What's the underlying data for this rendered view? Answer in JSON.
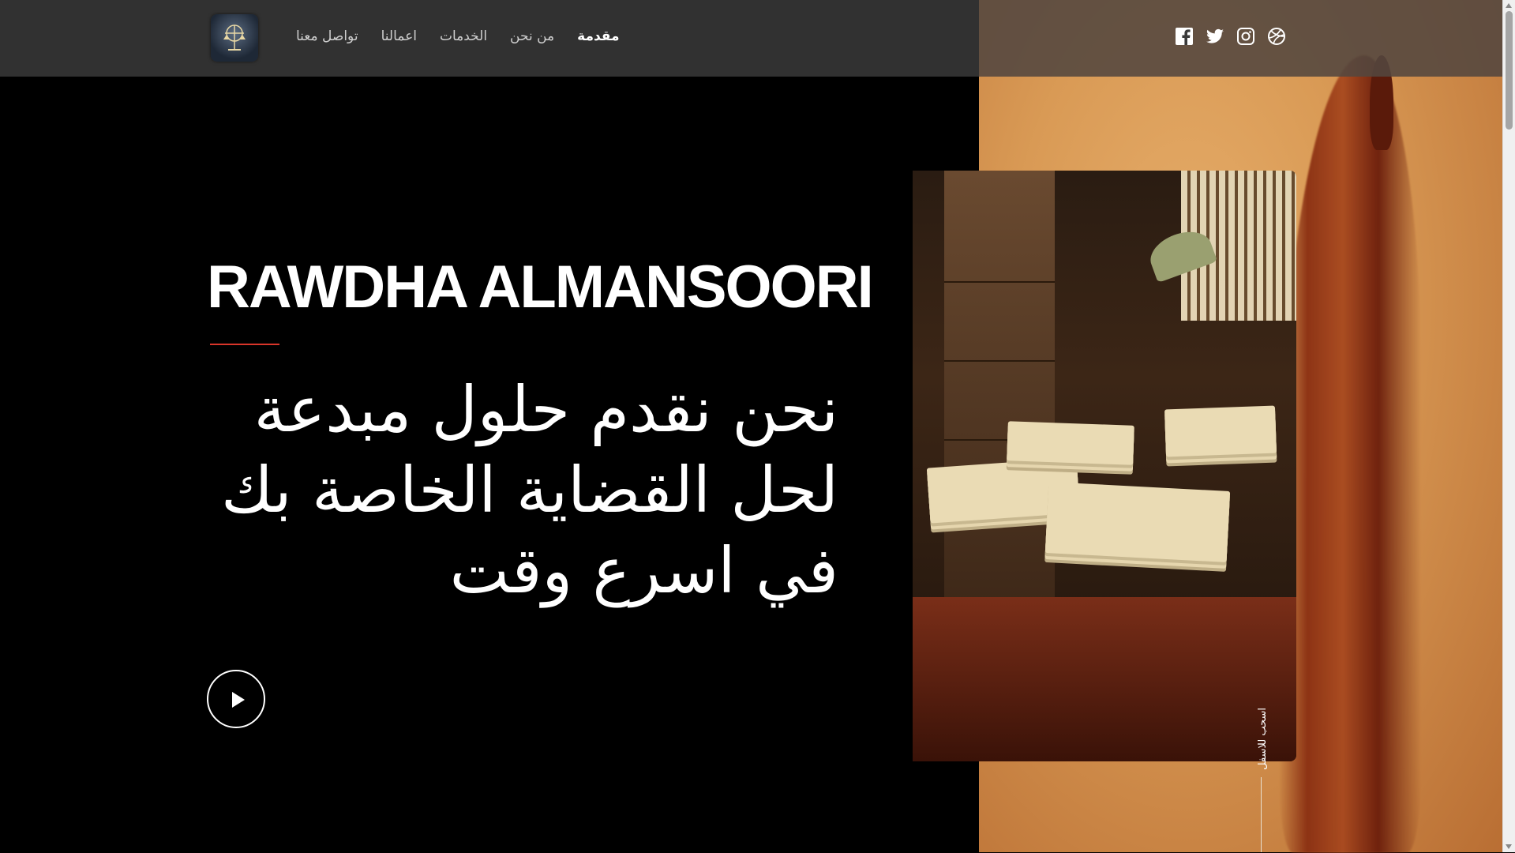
{
  "nav": {
    "items": [
      {
        "label": "مقدمة",
        "active": true
      },
      {
        "label": "من نحن",
        "active": false
      },
      {
        "label": "الخدمات",
        "active": false
      },
      {
        "label": "اعمالنا",
        "active": false
      },
      {
        "label": "تواصل معنا",
        "active": false
      }
    ]
  },
  "social": [
    "facebook-icon",
    "twitter-icon",
    "instagram-icon",
    "dribbble-icon"
  ],
  "hero": {
    "title": "RAWDHA ALMANSOORI",
    "subtitle_lines": [
      "نحن نقدم حلول مبدعة",
      "لحل القضاية الخاصة بك",
      "في اسرع وقت"
    ],
    "scroll_caption": "اسحب للاسفل"
  },
  "colors": {
    "accent_line": "#d9352a",
    "header_bg": "#3c3c3c",
    "panel_bg": "#d99a55"
  }
}
